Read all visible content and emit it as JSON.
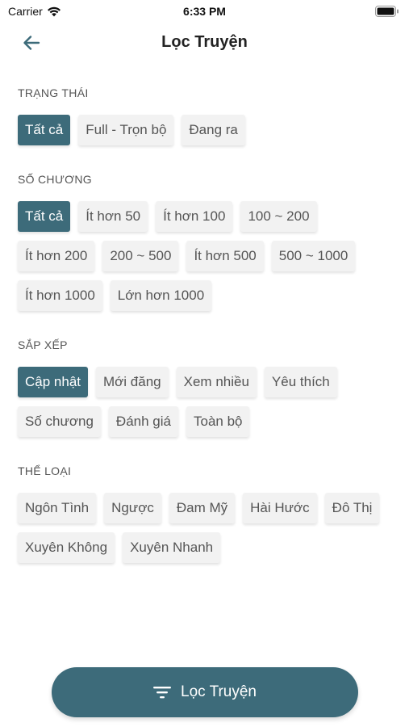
{
  "status_bar": {
    "carrier": "Carrier",
    "time": "6:33 PM"
  },
  "nav": {
    "title": "Lọc Truyện"
  },
  "sections": {
    "status": {
      "title": "TRẠNG THÁI",
      "options": [
        "Tất cả",
        "Full - Trọn bộ",
        "Đang ra"
      ],
      "selected": "Tất cả"
    },
    "chapters": {
      "title": "SỐ CHƯƠNG",
      "options": [
        "Tất cả",
        "Ít hơn 50",
        "Ít hơn 100",
        "100 ~ 200",
        "Ít hơn 200",
        "200 ~ 500",
        "Ít hơn 500",
        "500 ~ 1000",
        "Ít hơn 1000",
        "Lớn hơn 1000"
      ],
      "selected": "Tất cả"
    },
    "sort": {
      "title": "SẮP XẾP",
      "options": [
        "Cập nhật",
        "Mới đăng",
        "Xem nhiều",
        "Yêu thích",
        "Số chương",
        "Đánh giá",
        "Toàn bộ"
      ],
      "selected": "Cập nhật"
    },
    "genre": {
      "title": "THỂ LOẠI",
      "options": [
        "Ngôn Tình",
        "Ngược",
        "Đam Mỹ",
        "Hài Hước",
        "Đô Thị",
        "Xuyên Không",
        "Xuyên Nhanh"
      ]
    }
  },
  "filter_button": {
    "label": "Lọc Truyện",
    "icon": "filter-icon"
  },
  "colors": {
    "accent": "#3d6b7a",
    "chip_bg": "#f2f2f2",
    "chip_text": "#555555"
  }
}
